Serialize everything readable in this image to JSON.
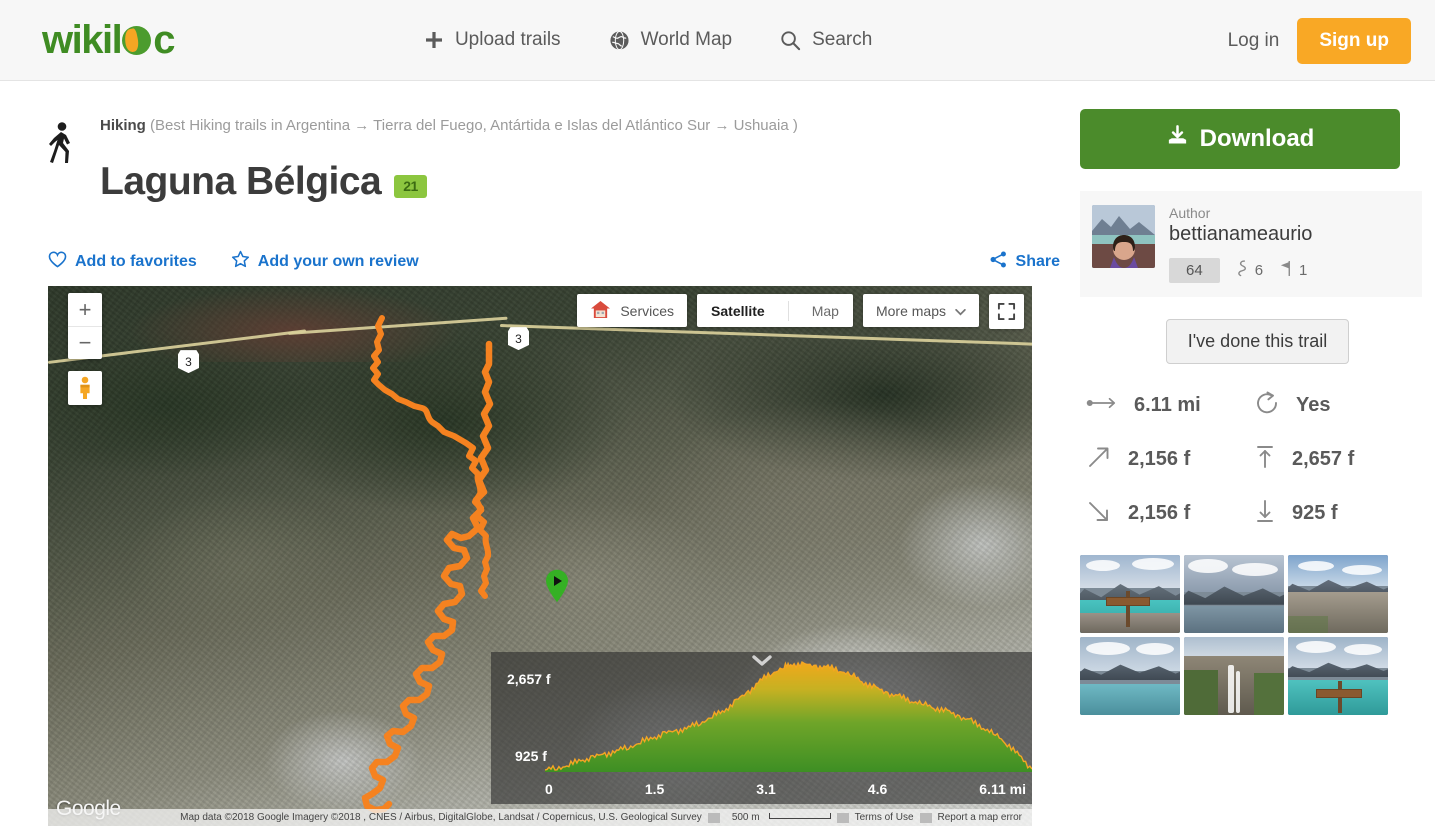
{
  "header": {
    "logo_text": "wikiloc",
    "nav": [
      {
        "label": "Upload trails",
        "icon": "plus-icon"
      },
      {
        "label": "World Map",
        "icon": "globe-icon"
      },
      {
        "label": "Search",
        "icon": "search-icon"
      }
    ],
    "login_label": "Log in",
    "signup_label": "Sign up"
  },
  "trail": {
    "activity": "Hiking",
    "breadcrumb_rest": "(Best Hiking trails in Argentina → Tierra del Fuego, Antártida e Islas del Atlántico Sur → Ushuaia )",
    "title": "Laguna Bélgica",
    "photo_count": "21",
    "activity_icon": "hiker-icon"
  },
  "actions": {
    "favorites_label": "Add to favorites",
    "favorites_icon": "heart-icon",
    "review_label": "Add your own review",
    "review_icon": "star-icon",
    "share_label": "Share",
    "share_icon": "share-icon"
  },
  "map": {
    "zoom_in": "+",
    "zoom_out": "−",
    "pegman_icon": "street-view-pegman-icon",
    "services_label": "Services",
    "services_icon": "house-icon",
    "layer_satellite": "Satellite",
    "layer_map": "Map",
    "more_maps_label": "More maps",
    "more_maps_icon": "chevron-down-icon",
    "fullscreen_icon": "expand-icon",
    "road_shield_1": "3",
    "road_shield_2": "3",
    "watermark": "Google",
    "attribution": "Map data ©2018 Google Imagery ©2018 , CNES / Airbus, DigitalGlobe, Landsat / Copernicus, U.S. Geological Survey",
    "scale_label": "500 m",
    "terms_label": "Terms of Use",
    "report_label": "Report a map error",
    "start_marker_icon": "start-play-marker-icon",
    "track_color": "#f58220"
  },
  "chart_data": {
    "type": "area",
    "title": "Elevation profile",
    "xlabel": "mi",
    "ylabel": "f",
    "ylim": [
      925,
      2657
    ],
    "xlim": [
      0,
      6.11
    ],
    "y_tick_max": "2,657 f",
    "y_tick_min": "925 f",
    "x_ticks": [
      "0",
      "1.5",
      "3.1",
      "4.6",
      "6.11 mi"
    ],
    "grid": false,
    "legend": "none",
    "fill_gradient": [
      "#3e8f24",
      "#9bbb2e",
      "#f1a81b"
    ],
    "x": [
      0,
      0.15,
      0.3,
      0.45,
      0.6,
      0.75,
      0.9,
      1.05,
      1.2,
      1.35,
      1.5,
      1.65,
      1.8,
      1.95,
      2.1,
      2.25,
      2.4,
      2.55,
      2.7,
      2.85,
      3.0,
      3.1,
      3.25,
      3.4,
      3.55,
      3.7,
      3.85,
      4.0,
      4.15,
      4.3,
      4.45,
      4.6,
      4.75,
      4.9,
      5.05,
      5.2,
      5.35,
      5.5,
      5.65,
      5.8,
      5.95,
      6.11
    ],
    "values": [
      925,
      960,
      1010,
      1080,
      1130,
      1180,
      1240,
      1300,
      1380,
      1450,
      1520,
      1560,
      1620,
      1700,
      1800,
      1900,
      2050,
      2200,
      2380,
      2520,
      2600,
      2657,
      2640,
      2620,
      2600,
      2560,
      2470,
      2360,
      2260,
      2180,
      2120,
      2060,
      2000,
      1940,
      1880,
      1800,
      1720,
      1620,
      1500,
      1360,
      1150,
      940
    ],
    "collapse_icon": "chevron-down-icon"
  },
  "sidebar": {
    "download_label": "Download",
    "download_icon": "download-icon",
    "author_label": "Author",
    "author_name": "bettianameaurio",
    "author_avatar_icon": "avatar-photo",
    "author_badge": "64",
    "author_trails_count": "6",
    "author_trails_icon": "trail-icon",
    "author_flags_count": "1",
    "author_flags_icon": "flag-icon",
    "done_trail_label": "I've done this trail",
    "stats": [
      {
        "icon": "distance-icon",
        "value": "6.11 mi"
      },
      {
        "icon": "loop-icon",
        "value": "Yes"
      },
      {
        "icon": "ascent-icon",
        "value": "2,156 f"
      },
      {
        "icon": "max-altitude-icon",
        "value": "2,657 f"
      },
      {
        "icon": "descent-icon",
        "value": "2,156 f"
      },
      {
        "icon": "min-altitude-icon",
        "value": "925 f"
      }
    ],
    "photos": [
      {
        "name": "lake-with-wooden-signpost"
      },
      {
        "name": "lake-and-cloudy-mountains"
      },
      {
        "name": "rocky-ridge-panorama"
      },
      {
        "name": "turquoise-lake-shore"
      },
      {
        "name": "waterfall-in-valley"
      },
      {
        "name": "signpost-over-turquoise-lake"
      }
    ]
  },
  "colors": {
    "brand_green": "#3f8c23",
    "accent_orange": "#f9a825",
    "link_blue": "#1a73cc",
    "download_green": "#4b8b2b",
    "badge_green": "#8cc63f"
  }
}
